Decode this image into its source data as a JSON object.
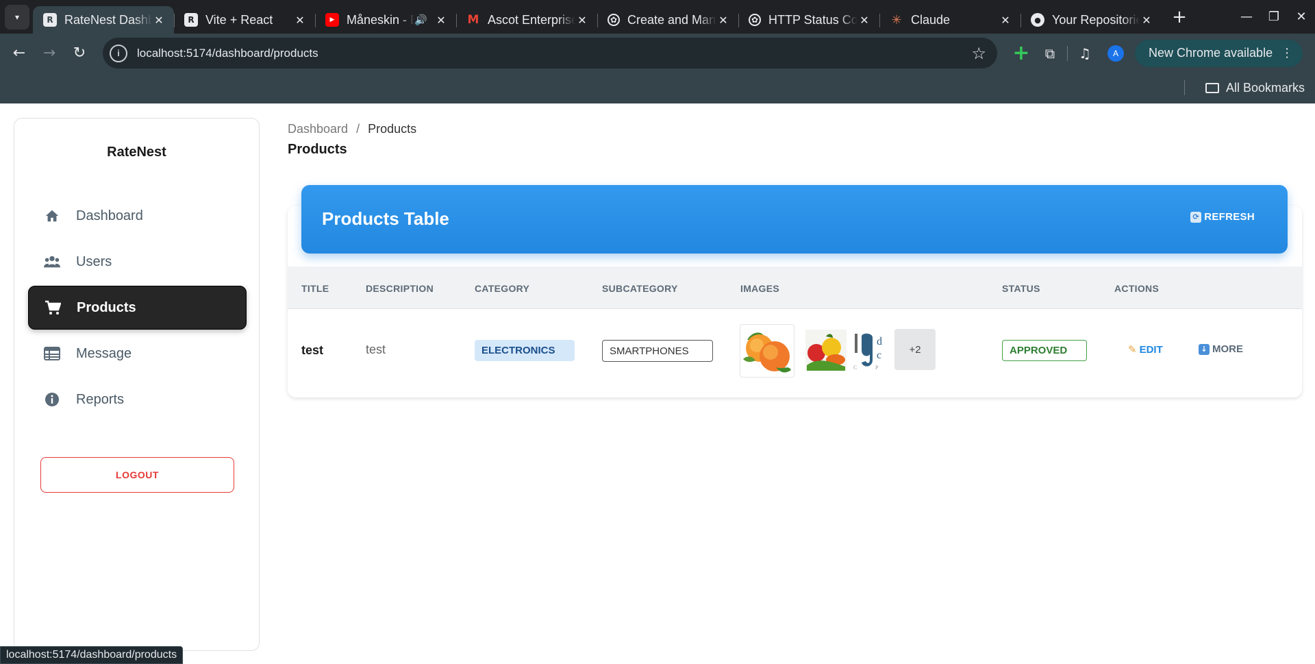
{
  "browser": {
    "tabs": [
      {
        "title": "RateNest Dashboard",
        "active": true,
        "favicon": "vite-react-icon"
      },
      {
        "title": "Vite + React",
        "active": false,
        "favicon": "vite-react-icon"
      },
      {
        "title": "Måneskin - Beggin'",
        "active": false,
        "favicon": "youtube-icon",
        "audio": true
      },
      {
        "title": "Ascot Enterprises",
        "active": false,
        "favicon": "gmail-icon"
      },
      {
        "title": "Create and Manage",
        "active": false,
        "favicon": "openai-icon"
      },
      {
        "title": "HTTP Status Codes",
        "active": false,
        "favicon": "openai-icon"
      },
      {
        "title": "Claude",
        "active": false,
        "favicon": "claude-icon"
      },
      {
        "title": "Your Repositories",
        "active": false,
        "favicon": "github-icon"
      }
    ],
    "url": "localhost:5174/dashboard/products",
    "update_label": "New Chrome available",
    "profile_initial": "A",
    "bookmarks_label": "All Bookmarks",
    "status_url": "localhost:5174/dashboard/products"
  },
  "sidebar": {
    "brand": "RateNest",
    "items": [
      {
        "label": "Dashboard",
        "icon": "home-icon",
        "active": false
      },
      {
        "label": "Users",
        "icon": "users-icon",
        "active": false
      },
      {
        "label": "Products",
        "icon": "cart-icon",
        "active": true
      },
      {
        "label": "Message",
        "icon": "table-icon",
        "active": false
      },
      {
        "label": "Reports",
        "icon": "info-icon",
        "active": false
      }
    ],
    "logout_label": "LOGOUT"
  },
  "breadcrumb": {
    "root": "Dashboard",
    "separator": "/",
    "current": "Products"
  },
  "page_title": "Products",
  "table_card": {
    "title": "Products Table",
    "refresh_label": "REFRESH",
    "columns": [
      "TITLE",
      "DESCRIPTION",
      "CATEGORY",
      "SUBCATEGORY",
      "IMAGES",
      "STATUS",
      "ACTIONS"
    ],
    "rows": [
      {
        "title": "test",
        "description": "test",
        "category": "ELECTRONICS",
        "subcategory": "SMARTPHONES",
        "extra_images": "+2",
        "status": "APPROVED",
        "edit_label": "EDIT",
        "more_label": "MORE"
      }
    ]
  },
  "colors": {
    "header_blue": "#2388e0",
    "active_nav": "#262626",
    "logout_red": "#e53935",
    "approved_green": "#2e7d32",
    "chrome_toolbar": "#35434a"
  }
}
